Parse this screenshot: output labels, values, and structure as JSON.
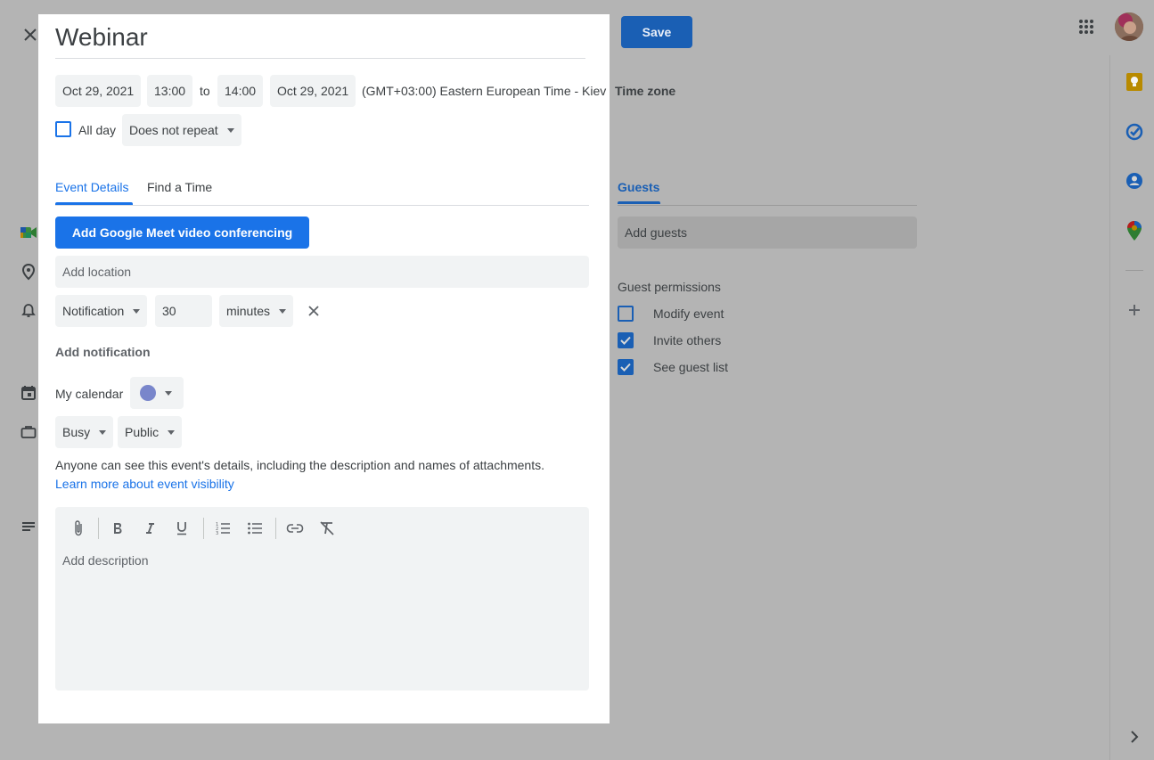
{
  "event": {
    "title": "Webinar",
    "start_date": "Oct 29, 2021",
    "start_time": "13:00",
    "to_label": "to",
    "end_time": "14:00",
    "end_date": "Oct 29, 2021",
    "timezone": "(GMT+03:00) Eastern European Time - Kiev"
  },
  "allday": {
    "label": "All day",
    "checked": false
  },
  "repeat": {
    "value": "Does not repeat"
  },
  "toolbar": {
    "save_label": "Save"
  },
  "timezone_link": "Time zone",
  "tabs": [
    {
      "label": "Event Details",
      "active": true
    },
    {
      "label": "Find a Time",
      "active": false
    }
  ],
  "meet_button": "Add Google Meet video conferencing",
  "location": {
    "placeholder": "Add location"
  },
  "notification": {
    "type": "Notification",
    "amount": "30",
    "unit": "minutes"
  },
  "add_notification": "Add notification",
  "calendar": {
    "name": "My calendar",
    "color": "#7986cb"
  },
  "availability": {
    "busy": "Busy",
    "visibility": "Public"
  },
  "visibility_note": "Anyone can see this event's details, including the description and names of attachments.",
  "visibility_link": "Learn more about event visibility",
  "description": {
    "placeholder": "Add description"
  },
  "guests": {
    "tab_label": "Guests",
    "placeholder": "Add guests",
    "permissions_title": "Guest permissions",
    "permissions": [
      {
        "label": "Modify event",
        "checked": false
      },
      {
        "label": "Invite others",
        "checked": true
      },
      {
        "label": "See guest list",
        "checked": true
      }
    ]
  },
  "colors": {
    "accent": "#1a73e8",
    "save": "#1a5fb4",
    "overlay": "#b4b4b4"
  }
}
